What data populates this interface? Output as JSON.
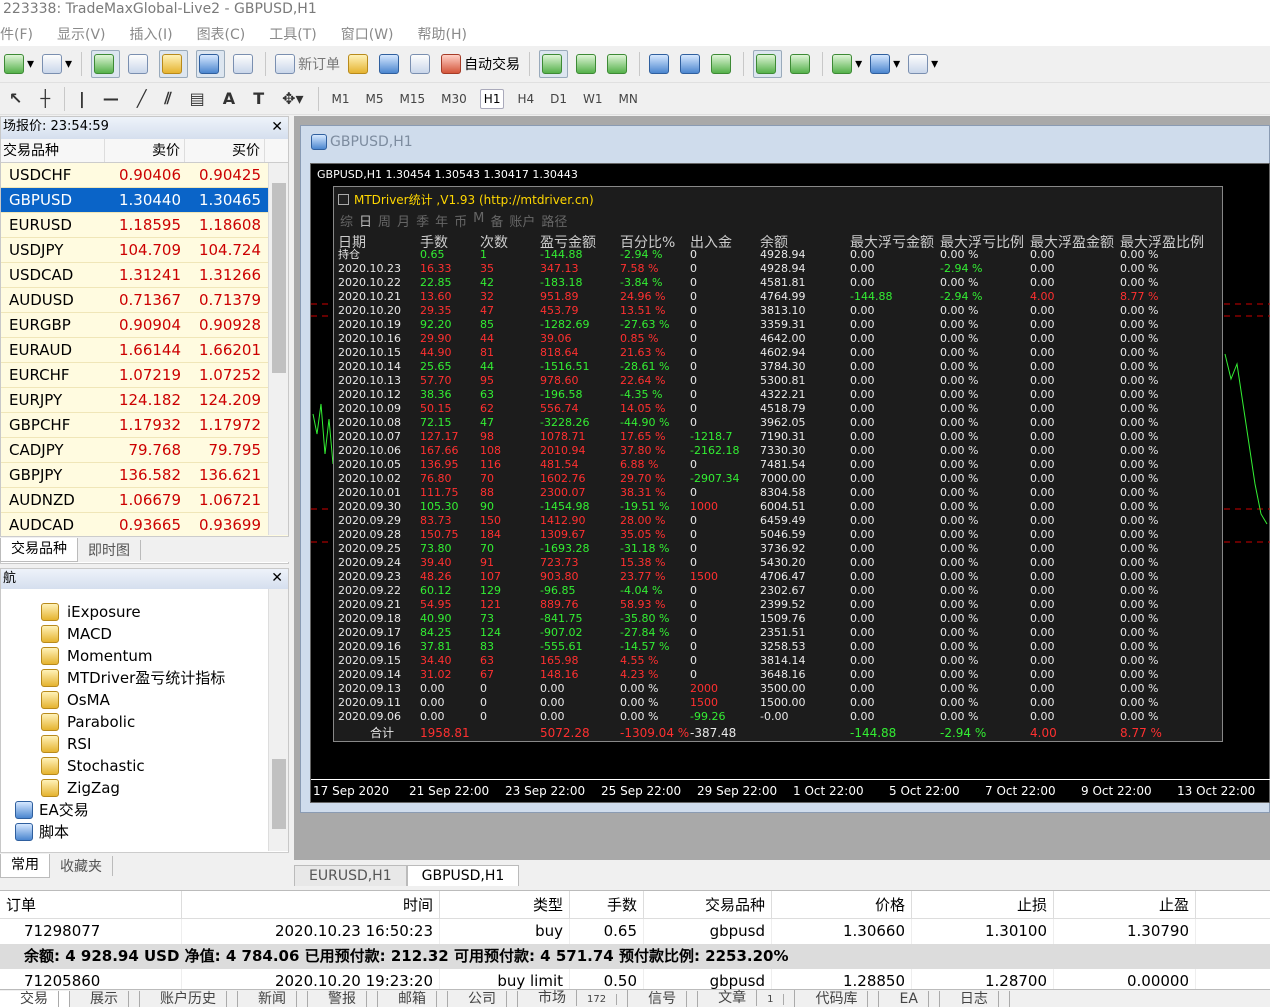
{
  "window": {
    "title": "223338: TradeMaxGlobal-Live2 - GBPUSD,H1"
  },
  "menu": [
    "件(F)",
    "显示(V)",
    "插入(I)",
    "图表(C)",
    "工具(T)",
    "窗口(W)",
    "帮助(H)"
  ],
  "toolbar": {
    "new_order": "新订单",
    "auto_trade": "自动交易"
  },
  "timeframes": [
    "M1",
    "M5",
    "M15",
    "M30",
    "H1",
    "H4",
    "D1",
    "W1",
    "MN"
  ],
  "active_timeframe": "H1",
  "market_watch": {
    "header": "场报价: 23:54:59",
    "col_symbol": "交易品种",
    "col_bid": "卖价",
    "col_ask": "买价",
    "rows": [
      {
        "symbol": "USDCHF",
        "bid": "0.90406",
        "ask": "0.90425"
      },
      {
        "symbol": "GBPUSD",
        "bid": "1.30440",
        "ask": "1.30465"
      },
      {
        "symbol": "EURUSD",
        "bid": "1.18595",
        "ask": "1.18608"
      },
      {
        "symbol": "USDJPY",
        "bid": "104.709",
        "ask": "104.724"
      },
      {
        "symbol": "USDCAD",
        "bid": "1.31241",
        "ask": "1.31266"
      },
      {
        "symbol": "AUDUSD",
        "bid": "0.71367",
        "ask": "0.71379"
      },
      {
        "symbol": "EURGBP",
        "bid": "0.90904",
        "ask": "0.90928"
      },
      {
        "symbol": "EURAUD",
        "bid": "1.66144",
        "ask": "1.66201"
      },
      {
        "symbol": "EURCHF",
        "bid": "1.07219",
        "ask": "1.07252"
      },
      {
        "symbol": "EURJPY",
        "bid": "124.182",
        "ask": "124.209"
      },
      {
        "symbol": "GBPCHF",
        "bid": "1.17932",
        "ask": "1.17972"
      },
      {
        "symbol": "CADJPY",
        "bid": "79.768",
        "ask": "79.795"
      },
      {
        "symbol": "GBPJPY",
        "bid": "136.582",
        "ask": "136.621"
      },
      {
        "symbol": "AUDNZD",
        "bid": "1.06679",
        "ask": "1.06721"
      },
      {
        "symbol": "AUDCAD",
        "bid": "0.93665",
        "ask": "0.93699"
      }
    ],
    "tabs": [
      "交易品种",
      "即时图"
    ]
  },
  "navigator": {
    "header": "航",
    "indicators": [
      "iExposure",
      "MACD",
      "Momentum",
      "MTDriver盈亏统计指标",
      "OsMA",
      "Parabolic",
      "RSI",
      "Stochastic",
      "ZigZag"
    ],
    "folders": [
      "EA交易",
      "脚本"
    ],
    "tabs": [
      "常用",
      "收藏夹"
    ]
  },
  "chart": {
    "window_title": "GBPUSD,H1",
    "info": "GBPUSD,H1  1.30454 1.30543 1.30417 1.30443",
    "xaxis": [
      "17 Sep 2020",
      "21 Sep 22:00",
      "23 Sep 22:00",
      "25 Sep 22:00",
      "29 Sep 22:00",
      "1 Oct 22:00",
      "5 Oct 22:00",
      "7 Oct 22:00",
      "9 Oct 22:00",
      "13 Oct 22:00"
    ]
  },
  "stats": {
    "title": "MTDriver统计 ,V1.93 (http://mtdriver.cn)",
    "tabs": [
      "综",
      "日",
      "周",
      "月",
      "季",
      "年",
      "币",
      "M",
      "备",
      "账户",
      "路径"
    ],
    "headers": [
      "日期",
      "手数",
      "次数",
      "盈亏金额",
      "百分比%",
      "出入金",
      "余额",
      "最大浮亏金额",
      "最大浮亏比例",
      "最大浮盈金额",
      "最大浮盈比例"
    ],
    "rows": [
      {
        "date": "持仓",
        "lots": "0.65",
        "count": "1",
        "pl": "-144.88",
        "pct": "-2.94 %",
        "dw": "0",
        "bal": "4928.94",
        "mfl": "0.00",
        "mflp": "0.00 %",
        "mfp": "0.00",
        "mfpp": "0.00 %",
        "win": false
      },
      {
        "date": "2020.10.23",
        "lots": "16.33",
        "count": "35",
        "pl": "347.13",
        "pct": "7.58 %",
        "dw": "0",
        "bal": "4928.94",
        "mfl": "0.00",
        "mflp": "-2.94 %",
        "mfp": "0.00",
        "mfpp": "0.00 %",
        "win": true
      },
      {
        "date": "2020.10.22",
        "lots": "22.85",
        "count": "42",
        "pl": "-183.18",
        "pct": "-3.84 %",
        "dw": "0",
        "bal": "4581.81",
        "mfl": "0.00",
        "mflp": "0.00 %",
        "mfp": "0.00",
        "mfpp": "0.00 %",
        "win": false
      },
      {
        "date": "2020.10.21",
        "lots": "13.60",
        "count": "32",
        "pl": "951.89",
        "pct": "24.96 %",
        "dw": "0",
        "bal": "4764.99",
        "mfl": "-144.88",
        "mflp": "-2.94 %",
        "mfp": "4.00",
        "mfpp": "8.77 %",
        "win": true
      },
      {
        "date": "2020.10.20",
        "lots": "29.35",
        "count": "47",
        "pl": "453.79",
        "pct": "13.51 %",
        "dw": "0",
        "bal": "3813.10",
        "mfl": "0.00",
        "mflp": "0.00 %",
        "mfp": "0.00",
        "mfpp": "0.00 %",
        "win": true
      },
      {
        "date": "2020.10.19",
        "lots": "92.20",
        "count": "85",
        "pl": "-1282.69",
        "pct": "-27.63 %",
        "dw": "0",
        "bal": "3359.31",
        "mfl": "0.00",
        "mflp": "0.00 %",
        "mfp": "0.00",
        "mfpp": "0.00 %",
        "win": false
      },
      {
        "date": "2020.10.16",
        "lots": "29.90",
        "count": "44",
        "pl": "39.06",
        "pct": "0.85 %",
        "dw": "0",
        "bal": "4642.00",
        "mfl": "0.00",
        "mflp": "0.00 %",
        "mfp": "0.00",
        "mfpp": "0.00 %",
        "win": true
      },
      {
        "date": "2020.10.15",
        "lots": "44.90",
        "count": "81",
        "pl": "818.64",
        "pct": "21.63 %",
        "dw": "0",
        "bal": "4602.94",
        "mfl": "0.00",
        "mflp": "0.00 %",
        "mfp": "0.00",
        "mfpp": "0.00 %",
        "win": true
      },
      {
        "date": "2020.10.14",
        "lots": "25.65",
        "count": "44",
        "pl": "-1516.51",
        "pct": "-28.61 %",
        "dw": "0",
        "bal": "3784.30",
        "mfl": "0.00",
        "mflp": "0.00 %",
        "mfp": "0.00",
        "mfpp": "0.00 %",
        "win": false
      },
      {
        "date": "2020.10.13",
        "lots": "57.70",
        "count": "95",
        "pl": "978.60",
        "pct": "22.64 %",
        "dw": "0",
        "bal": "5300.81",
        "mfl": "0.00",
        "mflp": "0.00 %",
        "mfp": "0.00",
        "mfpp": "0.00 %",
        "win": true
      },
      {
        "date": "2020.10.12",
        "lots": "38.36",
        "count": "63",
        "pl": "-196.58",
        "pct": "-4.35 %",
        "dw": "0",
        "bal": "4322.21",
        "mfl": "0.00",
        "mflp": "0.00 %",
        "mfp": "0.00",
        "mfpp": "0.00 %",
        "win": false
      },
      {
        "date": "2020.10.09",
        "lots": "50.15",
        "count": "62",
        "pl": "556.74",
        "pct": "14.05 %",
        "dw": "0",
        "bal": "4518.79",
        "mfl": "0.00",
        "mflp": "0.00 %",
        "mfp": "0.00",
        "mfpp": "0.00 %",
        "win": true
      },
      {
        "date": "2020.10.08",
        "lots": "72.15",
        "count": "47",
        "pl": "-3228.26",
        "pct": "-44.90 %",
        "dw": "0",
        "bal": "3962.05",
        "mfl": "0.00",
        "mflp": "0.00 %",
        "mfp": "0.00",
        "mfpp": "0.00 %",
        "win": false
      },
      {
        "date": "2020.10.07",
        "lots": "127.17",
        "count": "98",
        "pl": "1078.71",
        "pct": "17.65 %",
        "dw": "-1218.7",
        "bal": "7190.31",
        "mfl": "0.00",
        "mflp": "0.00 %",
        "mfp": "0.00",
        "mfpp": "0.00 %",
        "win": true
      },
      {
        "date": "2020.10.06",
        "lots": "167.66",
        "count": "108",
        "pl": "2010.94",
        "pct": "37.80 %",
        "dw": "-2162.18",
        "bal": "7330.30",
        "mfl": "0.00",
        "mflp": "0.00 %",
        "mfp": "0.00",
        "mfpp": "0.00 %",
        "win": true
      },
      {
        "date": "2020.10.05",
        "lots": "136.95",
        "count": "116",
        "pl": "481.54",
        "pct": "6.88 %",
        "dw": "0",
        "bal": "7481.54",
        "mfl": "0.00",
        "mflp": "0.00 %",
        "mfp": "0.00",
        "mfpp": "0.00 %",
        "win": true
      },
      {
        "date": "2020.10.02",
        "lots": "76.80",
        "count": "70",
        "pl": "1602.76",
        "pct": "29.70 %",
        "dw": "-2907.34",
        "bal": "7000.00",
        "mfl": "0.00",
        "mflp": "0.00 %",
        "mfp": "0.00",
        "mfpp": "0.00 %",
        "win": true
      },
      {
        "date": "2020.10.01",
        "lots": "111.75",
        "count": "88",
        "pl": "2300.07",
        "pct": "38.31 %",
        "dw": "0",
        "bal": "8304.58",
        "mfl": "0.00",
        "mflp": "0.00 %",
        "mfp": "0.00",
        "mfpp": "0.00 %",
        "win": true
      },
      {
        "date": "2020.09.30",
        "lots": "105.30",
        "count": "90",
        "pl": "-1454.98",
        "pct": "-19.51 %",
        "dw": "1000",
        "bal": "6004.51",
        "mfl": "0.00",
        "mflp": "0.00 %",
        "mfp": "0.00",
        "mfpp": "0.00 %",
        "win": false
      },
      {
        "date": "2020.09.29",
        "lots": "83.73",
        "count": "150",
        "pl": "1412.90",
        "pct": "28.00 %",
        "dw": "0",
        "bal": "6459.49",
        "mfl": "0.00",
        "mflp": "0.00 %",
        "mfp": "0.00",
        "mfpp": "0.00 %",
        "win": true
      },
      {
        "date": "2020.09.28",
        "lots": "150.75",
        "count": "184",
        "pl": "1309.67",
        "pct": "35.05 %",
        "dw": "0",
        "bal": "5046.59",
        "mfl": "0.00",
        "mflp": "0.00 %",
        "mfp": "0.00",
        "mfpp": "0.00 %",
        "win": true
      },
      {
        "date": "2020.09.25",
        "lots": "73.80",
        "count": "70",
        "pl": "-1693.28",
        "pct": "-31.18 %",
        "dw": "0",
        "bal": "3736.92",
        "mfl": "0.00",
        "mflp": "0.00 %",
        "mfp": "0.00",
        "mfpp": "0.00 %",
        "win": false
      },
      {
        "date": "2020.09.24",
        "lots": "39.40",
        "count": "91",
        "pl": "723.73",
        "pct": "15.38 %",
        "dw": "0",
        "bal": "5430.20",
        "mfl": "0.00",
        "mflp": "0.00 %",
        "mfp": "0.00",
        "mfpp": "0.00 %",
        "win": true
      },
      {
        "date": "2020.09.23",
        "lots": "48.26",
        "count": "107",
        "pl": "903.80",
        "pct": "23.77 %",
        "dw": "1500",
        "bal": "4706.47",
        "mfl": "0.00",
        "mflp": "0.00 %",
        "mfp": "0.00",
        "mfpp": "0.00 %",
        "win": true
      },
      {
        "date": "2020.09.22",
        "lots": "60.12",
        "count": "129",
        "pl": "-96.85",
        "pct": "-4.04 %",
        "dw": "0",
        "bal": "2302.67",
        "mfl": "0.00",
        "mflp": "0.00 %",
        "mfp": "0.00",
        "mfpp": "0.00 %",
        "win": false
      },
      {
        "date": "2020.09.21",
        "lots": "54.95",
        "count": "121",
        "pl": "889.76",
        "pct": "58.93 %",
        "dw": "0",
        "bal": "2399.52",
        "mfl": "0.00",
        "mflp": "0.00 %",
        "mfp": "0.00",
        "mfpp": "0.00 %",
        "win": true
      },
      {
        "date": "2020.09.18",
        "lots": "40.90",
        "count": "73",
        "pl": "-841.75",
        "pct": "-35.80 %",
        "dw": "0",
        "bal": "1509.76",
        "mfl": "0.00",
        "mflp": "0.00 %",
        "mfp": "0.00",
        "mfpp": "0.00 %",
        "win": false
      },
      {
        "date": "2020.09.17",
        "lots": "84.25",
        "count": "124",
        "pl": "-907.02",
        "pct": "-27.84 %",
        "dw": "0",
        "bal": "2351.51",
        "mfl": "0.00",
        "mflp": "0.00 %",
        "mfp": "0.00",
        "mfpp": "0.00 %",
        "win": false
      },
      {
        "date": "2020.09.16",
        "lots": "37.81",
        "count": "83",
        "pl": "-555.61",
        "pct": "-14.57 %",
        "dw": "0",
        "bal": "3258.53",
        "mfl": "0.00",
        "mflp": "0.00 %",
        "mfp": "0.00",
        "mfpp": "0.00 %",
        "win": false
      },
      {
        "date": "2020.09.15",
        "lots": "34.40",
        "count": "63",
        "pl": "165.98",
        "pct": "4.55 %",
        "dw": "0",
        "bal": "3814.14",
        "mfl": "0.00",
        "mflp": "0.00 %",
        "mfp": "0.00",
        "mfpp": "0.00 %",
        "win": true
      },
      {
        "date": "2020.09.14",
        "lots": "31.02",
        "count": "67",
        "pl": "148.16",
        "pct": "4.23 %",
        "dw": "0",
        "bal": "3648.16",
        "mfl": "0.00",
        "mflp": "0.00 %",
        "mfp": "0.00",
        "mfpp": "0.00 %",
        "win": true
      },
      {
        "date": "2020.09.13",
        "lots": "0.00",
        "count": "0",
        "pl": "0.00",
        "pct": "0.00 %",
        "dw": "2000",
        "bal": "3500.00",
        "mfl": "0.00",
        "mflp": "0.00 %",
        "mfp": "0.00",
        "mfpp": "0.00 %",
        "win": null
      },
      {
        "date": "2020.09.11",
        "lots": "0.00",
        "count": "0",
        "pl": "0.00",
        "pct": "0.00 %",
        "dw": "1500",
        "bal": "1500.00",
        "mfl": "0.00",
        "mflp": "0.00 %",
        "mfp": "0.00",
        "mfpp": "0.00 %",
        "win": null
      },
      {
        "date": "2020.09.06",
        "lots": "0.00",
        "count": "0",
        "pl": "0.00",
        "pct": "0.00 %",
        "dw": "-99.26",
        "bal": "-0.00",
        "mfl": "0.00",
        "mflp": "0.00 %",
        "mfp": "0.00",
        "mfpp": "0.00 %",
        "win": null
      }
    ],
    "total": {
      "label": "合计",
      "lots": "1958.81",
      "pl": "5072.28",
      "pct": "-1309.04 %",
      "dw": "-387.48",
      "mfl": "-144.88",
      "mflp": "-2.94 %",
      "mfp": "4.00",
      "mfpp": "8.77 %"
    }
  },
  "chart_tabs": [
    "EURUSD,H1",
    "GBPUSD,H1"
  ],
  "terminal": {
    "headers": [
      "订单",
      "时间",
      "类型",
      "手数",
      "交易品种",
      "价格",
      "止损",
      "止盈"
    ],
    "rows": [
      {
        "order": "71298077",
        "time": "2020.10.23 16:50:23",
        "type": "buy",
        "lots": "0.65",
        "symbol": "gbpusd",
        "price": "1.30660",
        "sl": "1.30100",
        "tp": "1.30790"
      }
    ],
    "balance_line": "余额: 4 928.94 USD  净值: 4 784.06  已用预付款: 212.32  可用预付款: 4 571.74  预付款比例: 2253.20%",
    "pending_rows": [
      {
        "order": "71205860",
        "time": "2020.10.20 19:23:20",
        "type": "buy limit",
        "lots": "0.50",
        "symbol": "gbpusd",
        "price": "1.28850",
        "sl": "1.28700",
        "tp": "0.00000"
      }
    ],
    "tabs": [
      {
        "label": "交易",
        "badge": ""
      },
      {
        "label": "展示",
        "badge": ""
      },
      {
        "label": "账户历史",
        "badge": ""
      },
      {
        "label": "新闻",
        "badge": ""
      },
      {
        "label": "警报",
        "badge": ""
      },
      {
        "label": "邮箱",
        "badge": ""
      },
      {
        "label": "公司",
        "badge": ""
      },
      {
        "label": "市场",
        "badge": "172"
      },
      {
        "label": "信号",
        "badge": ""
      },
      {
        "label": "文章",
        "badge": "1"
      },
      {
        "label": "代码库",
        "badge": ""
      },
      {
        "label": "EA",
        "badge": ""
      },
      {
        "label": "日志",
        "badge": ""
      }
    ]
  }
}
